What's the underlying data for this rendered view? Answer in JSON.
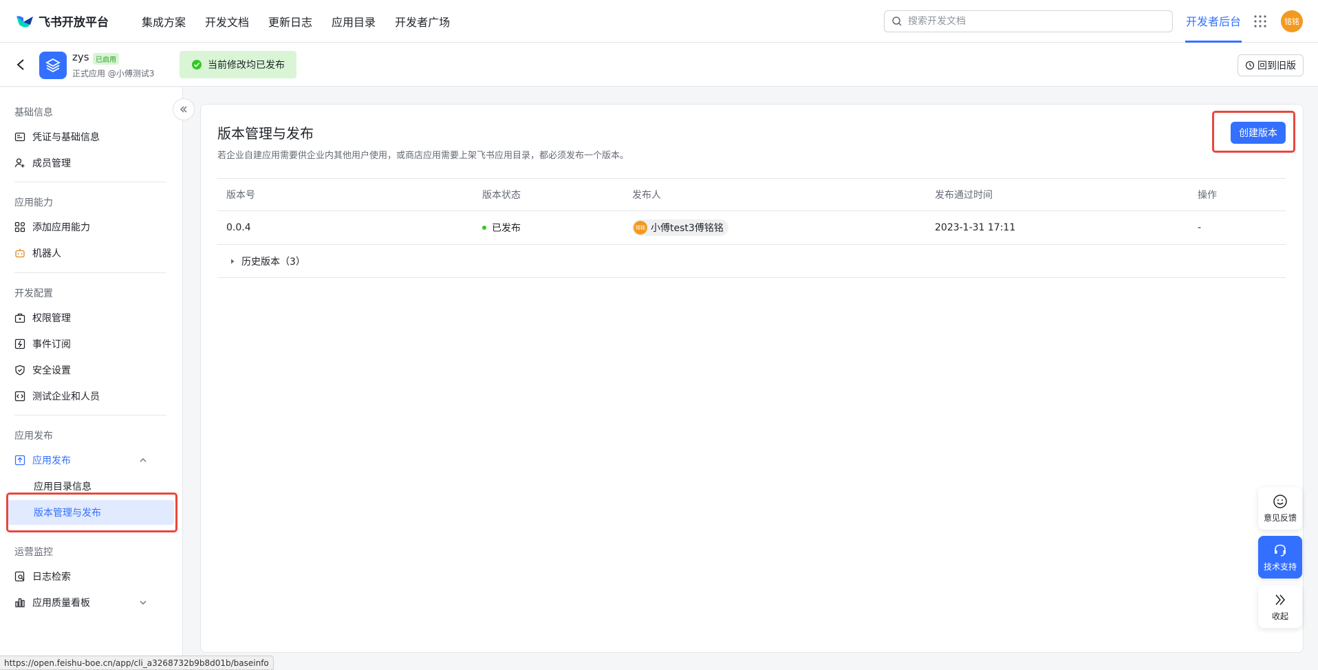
{
  "topbar": {
    "logo_text": "飞书开放平台",
    "nav": [
      "集成方案",
      "开发文档",
      "更新日志",
      "应用目录",
      "开发者广场"
    ],
    "search_placeholder": "搜索开发文档",
    "dev_console": "开发者后台",
    "user_avatar": "铭铭"
  },
  "app": {
    "name": "zys",
    "badge": "已启用",
    "subtitle": "正式应用 @小傅测试3",
    "publish_status": "当前修改均已发布",
    "old_version": "回到旧版"
  },
  "sidebar": {
    "groups": [
      {
        "title": "基础信息",
        "items": [
          "凭证与基础信息",
          "成员管理"
        ]
      },
      {
        "title": "应用能力",
        "items": [
          "添加应用能力",
          "机器人"
        ]
      },
      {
        "title": "开发配置",
        "items": [
          "权限管理",
          "事件订阅",
          "安全设置",
          "测试企业和人员"
        ]
      },
      {
        "title": "应用发布",
        "items": [
          "应用发布"
        ],
        "subitems": [
          "应用目录信息",
          "版本管理与发布"
        ]
      },
      {
        "title": "运营监控",
        "items": [
          "日志检索",
          "应用质量看板"
        ]
      }
    ]
  },
  "main": {
    "title": "版本管理与发布",
    "description": "若企业自建应用需要供企业内其他用户使用，或商店应用需要上架飞书应用目录，都必须发布一个版本。",
    "create_button": "创建版本",
    "table": {
      "headers": [
        "版本号",
        "版本状态",
        "发布人",
        "发布通过时间",
        "操作"
      ],
      "rows": [
        {
          "version": "0.0.4",
          "status": "已发布",
          "publisher_avatar": "铭铭",
          "publisher": "小傅test3傅铭铭",
          "time": "2023-1-31 17:11",
          "action": "-"
        }
      ]
    },
    "history": "历史版本（3）"
  },
  "float": {
    "feedback": "意见反馈",
    "support": "技术支持",
    "collapse": "收起"
  },
  "status_url": "https://open.feishu-boe.cn/app/cli_a3268732b9b8d01b/baseinfo",
  "colors": {
    "accent": "#3370ff",
    "success": "#34c724",
    "highlight": "#e8473c",
    "avatar": "#f39a1e"
  }
}
